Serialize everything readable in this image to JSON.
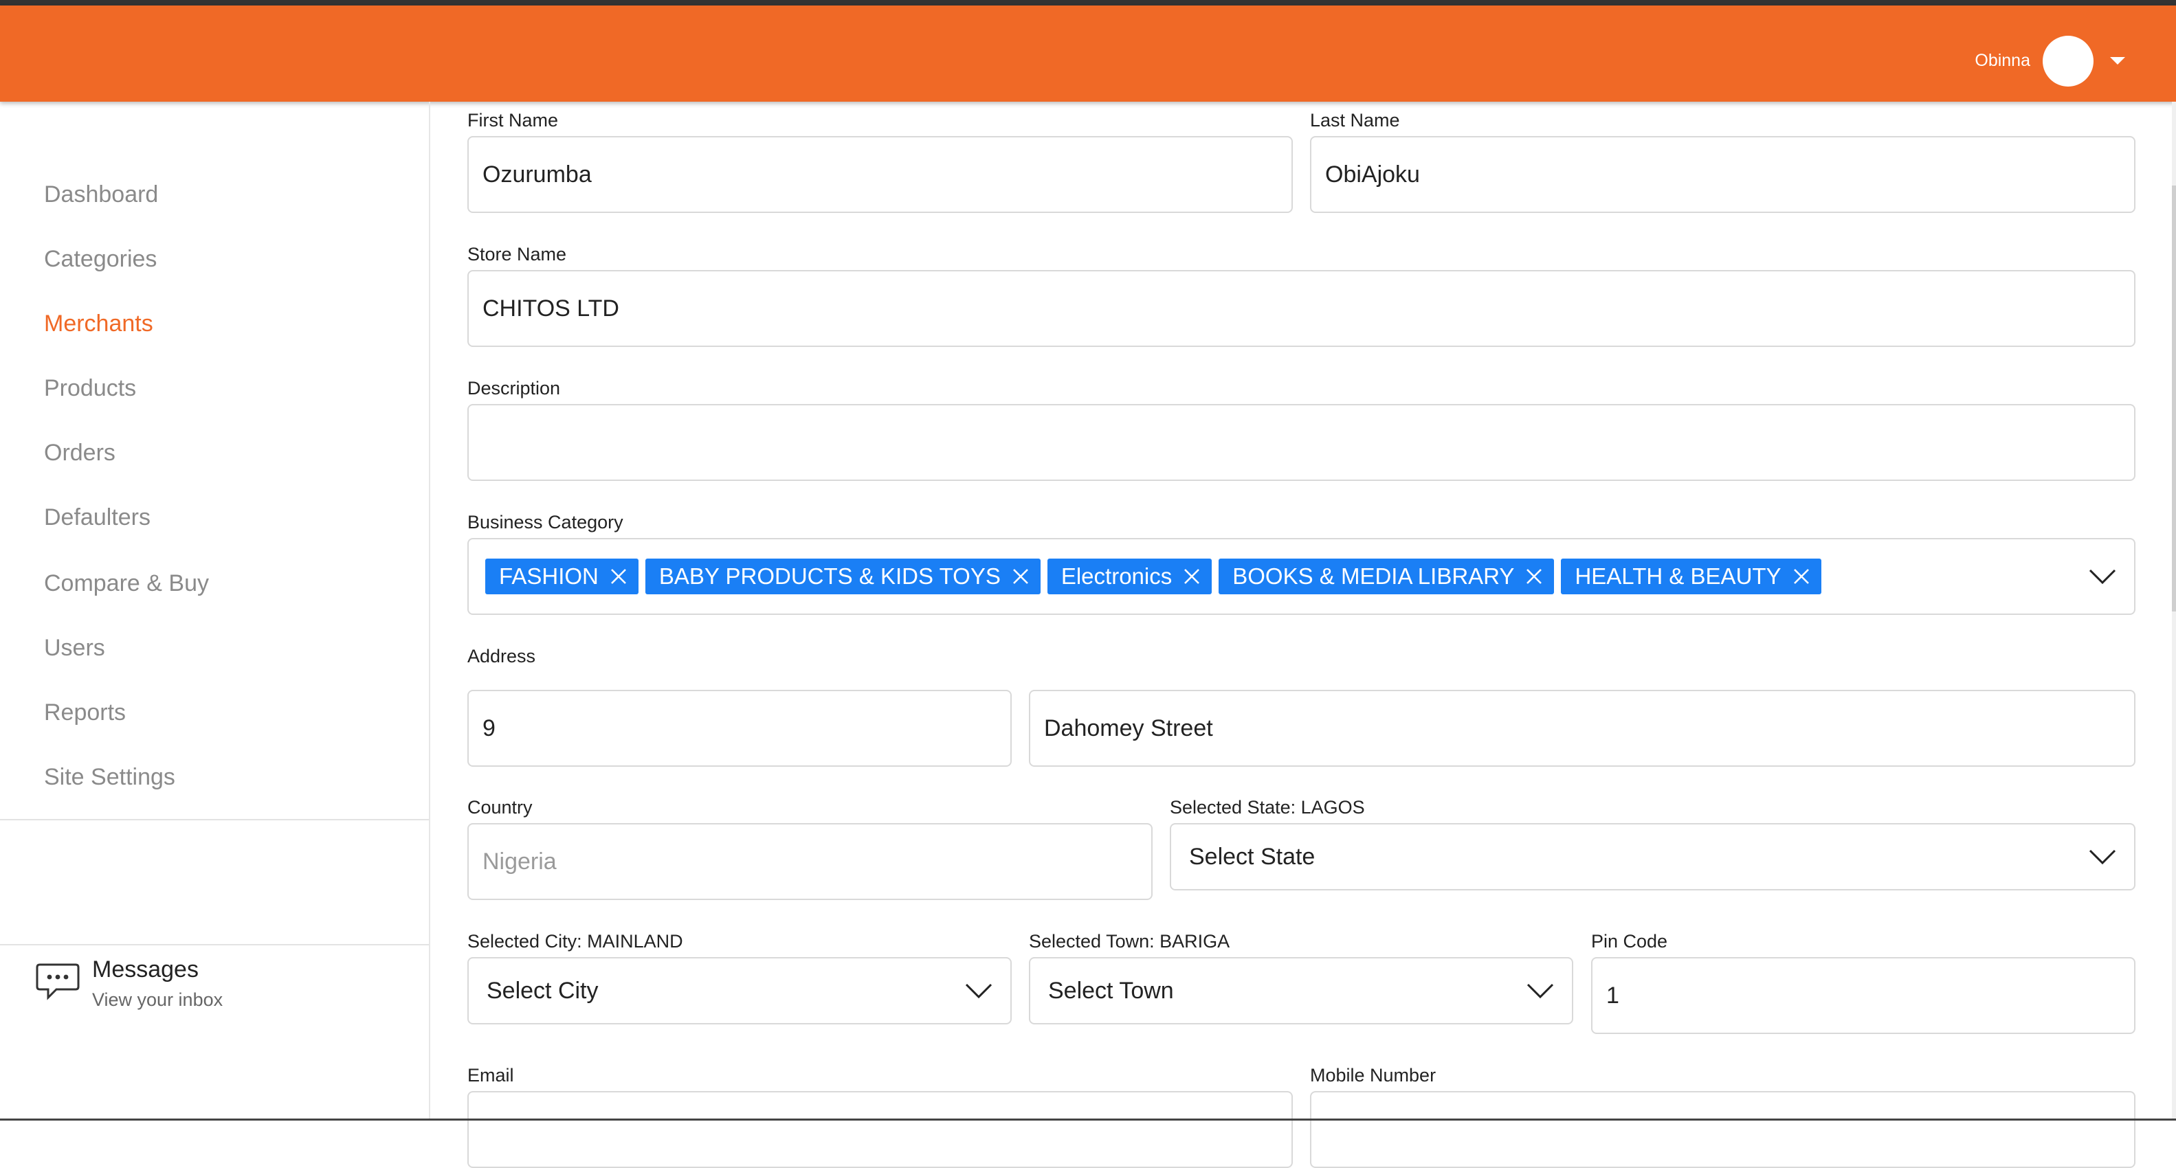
{
  "header": {
    "user_name": "Obinna"
  },
  "sidebar": {
    "items": [
      {
        "label": "Dashboard"
      },
      {
        "label": "Categories"
      },
      {
        "label": "Merchants",
        "active": true
      },
      {
        "label": "Products"
      },
      {
        "label": "Orders"
      },
      {
        "label": "Defaulters"
      },
      {
        "label": "Compare & Buy"
      },
      {
        "label": "Users"
      },
      {
        "label": "Reports"
      },
      {
        "label": "Site Settings"
      }
    ],
    "messages": {
      "title": "Messages",
      "subtitle": "View your inbox"
    }
  },
  "form": {
    "first_name": {
      "label": "First Name",
      "value": "Ozurumba"
    },
    "last_name": {
      "label": "Last Name",
      "value": "ObiAjoku"
    },
    "store_name": {
      "label": "Store Name",
      "value": "CHITOS LTD"
    },
    "description": {
      "label": "Description",
      "value": ""
    },
    "business_category": {
      "label": "Business Category",
      "chips": [
        "FASHION",
        "BABY PRODUCTS & KIDS TOYS",
        "Electronics",
        "BOOKS & MEDIA LIBRARY",
        "HEALTH & BEAUTY"
      ]
    },
    "address": {
      "label": "Address",
      "number": "9",
      "street": "Dahomey Street"
    },
    "country": {
      "label": "Country",
      "value": "Nigeria"
    },
    "state": {
      "label": "Selected State: LAGOS",
      "value": "Select State"
    },
    "city": {
      "label": "Selected City: MAINLAND",
      "value": "Select City"
    },
    "town": {
      "label": "Selected Town: BARIGA",
      "value": "Select Town"
    },
    "pin_code": {
      "label": "Pin Code",
      "value": "1"
    },
    "email": {
      "label": "Email",
      "value": ""
    },
    "mobile": {
      "label": "Mobile Number",
      "value": ""
    }
  },
  "colors": {
    "brand": "#F06926",
    "chip": "#1a7ff5",
    "nav_inactive": "#8a8a8a"
  },
  "icons": [
    "chevron-down-icon",
    "close-icon",
    "chat-bubble-icon",
    "caret-down-icon"
  ]
}
